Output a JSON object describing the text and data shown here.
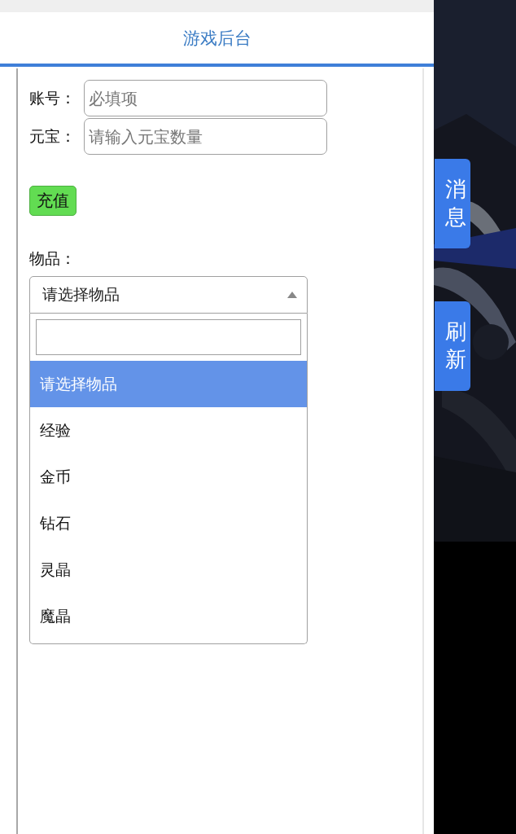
{
  "header": {
    "title": "游戏后台"
  },
  "form": {
    "fields": [
      {
        "label": "账号：",
        "placeholder": "必填项"
      },
      {
        "label": "元宝：",
        "placeholder": "请输入元宝数量"
      }
    ],
    "submit_button": "充值",
    "item_label": "物品：",
    "item_select": {
      "value": "请选择物品",
      "expanded": true,
      "options": [
        {
          "label": "请选择物品",
          "selected": true
        },
        {
          "label": "经验",
          "selected": false
        },
        {
          "label": "金币",
          "selected": false
        },
        {
          "label": "钻石",
          "selected": false
        },
        {
          "label": "灵晶",
          "selected": false
        },
        {
          "label": "魔晶",
          "selected": false
        }
      ]
    }
  },
  "side_tabs": [
    "消息",
    "刷新"
  ]
}
